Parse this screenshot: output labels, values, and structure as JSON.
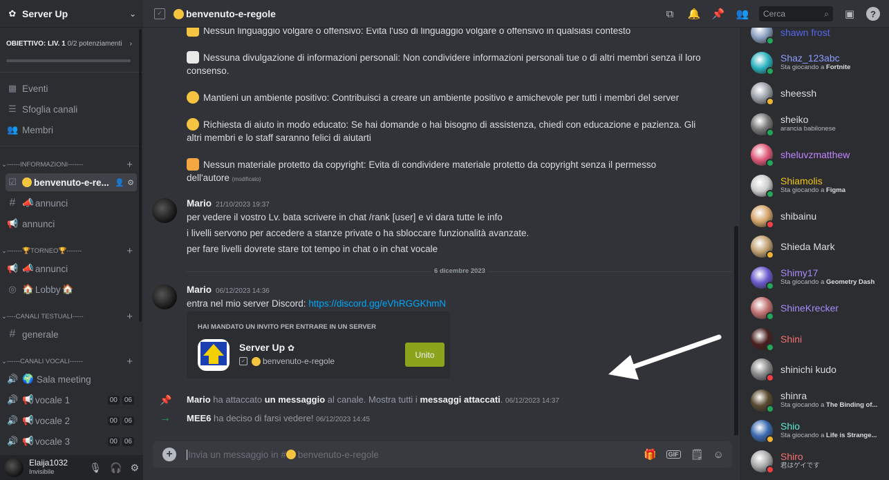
{
  "sidebar": {
    "server_name": "Server Up",
    "objective_label": "OBIETTIVO: LIV. 1",
    "objective_progress": "0/2 potenziamenti",
    "objective_fraction": 0,
    "nav": [
      {
        "label": "Eventi"
      },
      {
        "label": "Sfoglia canali"
      },
      {
        "label": "Membri"
      }
    ],
    "categories": {
      "info": "------INFORMAZIONI-------",
      "torneo_left": "-------",
      "torneo_mid": " TORNEO ",
      "torneo_right": " -------",
      "testuali": "----CANALI TESTUALI-----",
      "vocali": "------CANALI VOCALI------"
    },
    "channels": {
      "benvenuto": "benvenuto-e-re...",
      "annunci1": "annunci",
      "annunci2": "annunci",
      "annunci3": "annunci",
      "lobby": "Lobby",
      "generale": "generale",
      "sala": "Sala meeting",
      "vocale1": "vocale 1",
      "vocale2": "vocale 2",
      "vocale3": "vocale 3",
      "badge_a": "00",
      "badge_b": "06"
    },
    "user": {
      "name": "Elaija1032",
      "status": "Invisibile"
    }
  },
  "header": {
    "channel_title": "benvenuto-e-regole",
    "search_placeholder": "Cerca"
  },
  "messages": {
    "rules": [
      "Nessun linguaggio volgare o offensivo: Evita l'uso di linguaggio volgare o offensivo in qualsiasi contesto",
      "Nessuna divulgazione di informazioni personali: Non condividere informazioni personali tue o di altri membri senza il loro",
      "consenso.",
      "Mantieni un ambiente positivo: Contribuisci a creare un ambiente positivo e amichevole per tutti i membri del server",
      "Richiesta di aiuto in modo educato: Se hai domande o hai bisogno di assistenza, chiedi con educazione e pazienza. Gli",
      "altri membri e lo staff saranno felici di aiutarti",
      "Nessun materiale protetto da copyright: Evita di condividere materiale protetto da copyright senza il permesso",
      "dell'autore",
      "(modificato)"
    ],
    "msg1": {
      "author": "Mario",
      "timestamp": "21/10/2023 19:37",
      "lines": [
        "per vedere il vostro Lv. bata scrivere in chat /rank [user] e vi dara tutte le info",
        "i livelli servono per accedere a stanze private o ha sbloccare funzionalità avanzate.",
        "per fare livelli dovrete stare tot tempo in chat o in chat vocale"
      ]
    },
    "date_divider": "6 dicembre 2023",
    "msg2": {
      "author": "Mario",
      "timestamp": "06/12/2023 14:36",
      "text": "entra nel mio server Discord: ",
      "link": "https://discord.gg/eVhRGGKhmN"
    },
    "invite": {
      "heading": "HAI MANDATO UN INVITO PER ENTRARE IN UN SERVER",
      "server_name": "Server Up",
      "channel": "benvenuto-e-regole",
      "button": "Unito"
    },
    "sys1": {
      "author": "Mario",
      "pre": " ha attaccato ",
      "bold1": "un messaggio",
      "mid": " al canale. Mostra tutti i ",
      "bold2": "messaggi attaccati",
      "post": ".",
      "timestamp": "06/12/2023 14:37"
    },
    "sys2": {
      "author": "MEE6",
      "text": " ha deciso di farsi vedere! ",
      "timestamp": "06/12/2023 14:45"
    }
  },
  "composer": {
    "placeholder_pre": "Invia un messaggio in #",
    "placeholder_channel": "benvenuto-e-regole"
  },
  "members": [
    {
      "name": "shawn frost",
      "status": "",
      "color": "#5865f2",
      "presence": "online"
    },
    {
      "name": "Shaz_123abc",
      "status_pre": "Sta giocando a ",
      "game": "Fortnite",
      "color": "#8c9eff",
      "presence": "online"
    },
    {
      "name": "sheessh",
      "status": "",
      "color": "#dbdee1",
      "presence": "idle"
    },
    {
      "name": "sheiko",
      "status": "arancia babilonese",
      "color": "#dbdee1",
      "presence": "online"
    },
    {
      "name": "sheluvzmatthew",
      "status": "",
      "color": "#c084fc",
      "presence": "online"
    },
    {
      "name": "Shiamolis",
      "status_pre": "Sta giocando a ",
      "game": "Figma",
      "color": "#f1c40f",
      "presence": "online"
    },
    {
      "name": "shibainu",
      "status": "",
      "color": "#dbdee1",
      "presence": "dnd"
    },
    {
      "name": "Shieda Mark",
      "status": "",
      "color": "#dbdee1",
      "presence": "idle"
    },
    {
      "name": "Shimy17",
      "status_pre": "Sta giocando a ",
      "game": "Geometry Dash",
      "color": "#a78bfa",
      "presence": "online"
    },
    {
      "name": "ShineKrecker",
      "status": "",
      "color": "#a78bfa",
      "presence": "online"
    },
    {
      "name": "Shini",
      "status": "",
      "color": "#f87171",
      "presence": "online"
    },
    {
      "name": "shinichi kudo",
      "status": "",
      "color": "#dbdee1",
      "presence": "dnd"
    },
    {
      "name": "shinra",
      "status_pre": "Sta giocando a ",
      "game": "The Binding of...",
      "color": "#dbdee1",
      "presence": "online"
    },
    {
      "name": "Shio",
      "status_pre": "Sta giocando a ",
      "game": "Life is Strange...",
      "color": "#5eead4",
      "presence": "idle"
    },
    {
      "name": "Shiro",
      "status": "君はゲイです",
      "color": "#f87171",
      "presence": "dnd"
    }
  ]
}
